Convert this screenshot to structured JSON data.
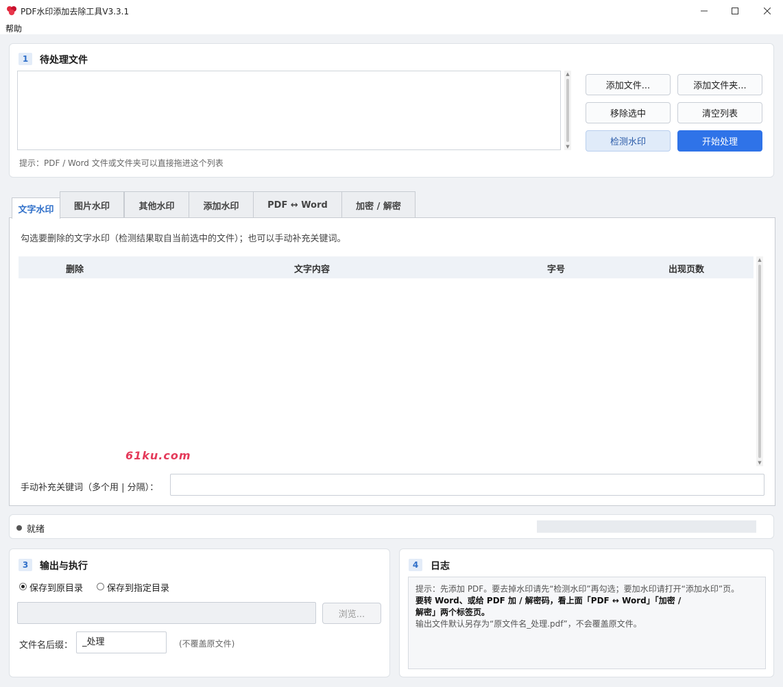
{
  "window": {
    "title": "PDF水印添加去除工具V3.3.1",
    "minimize": "—",
    "maximize": "☐",
    "close": "✕"
  },
  "menu": {
    "help": "帮助"
  },
  "section1": {
    "num": "1",
    "title": "待处理文件",
    "hint": "提示：PDF / Word 文件或文件夹可以直接拖进这个列表",
    "buttons": {
      "add_file": "添加文件...",
      "add_folder": "添加文件夹...",
      "remove_selected": "移除选中",
      "clear_list": "清空列表",
      "detect": "检测水印",
      "start": "开始处理"
    }
  },
  "tabs": [
    "文字水印",
    "图片水印",
    "其他水印",
    "添加水印",
    "PDF ↔ Word",
    "加密 / 解密"
  ],
  "text_tab": {
    "instruction": "勾选要删除的文字水印（检测结果取自当前选中的文件）；也可以手动补充关键词。",
    "columns": [
      "删除",
      "文字内容",
      "字号",
      "出现页数"
    ],
    "keyword_label": "手动补充关键词（多个用 | 分隔）：",
    "keyword_value": ""
  },
  "overlay_watermark": "61ku.com",
  "status": {
    "text": "就绪",
    "progress": 0
  },
  "section3": {
    "num": "3",
    "title": "输出与执行",
    "radio_original": "保存到原目录",
    "radio_custom": "保存到指定目录",
    "selected": "original",
    "dir_value": "",
    "browse": "浏览...",
    "suffix_label": "文件名后缀：",
    "suffix_value": "_处理",
    "suffix_note": "(不覆盖原文件)"
  },
  "section4": {
    "num": "4",
    "title": "日志",
    "lines": [
      "提示：先添加 PDF。要去掉水印请先“检测水印”再勾选；要加水印请打开“添加水印”页。",
      "要转 Word、或给 PDF 加 / 解密码，看上面「PDF ↔ Word」「加密 /",
      "解密」两个标签页。",
      "输出文件默认另存为“原文件名_处理.pdf”，不会覆盖原文件。"
    ]
  },
  "colors": {
    "accent": "#2f73e8",
    "section_number": "#2f6fc9",
    "watermark_overlay": "#e43a5a"
  }
}
